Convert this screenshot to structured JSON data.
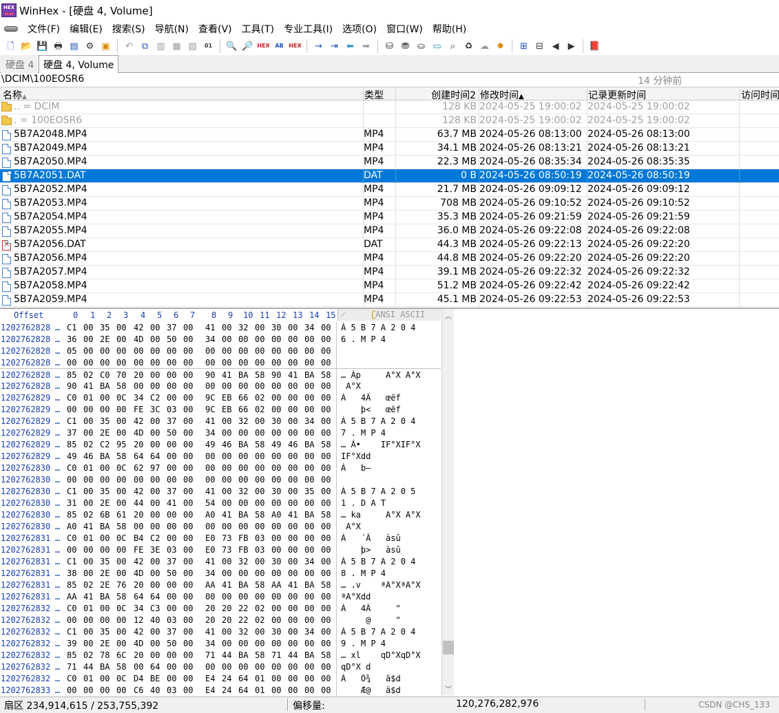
{
  "window": {
    "title": "WinHex - [硬盘 4, Volume]",
    "logo_text": "HEX"
  },
  "menu": [
    "文件(F)",
    "编辑(E)",
    "搜索(S)",
    "导航(N)",
    "查看(V)",
    "工具(T)",
    "专业工具(I)",
    "选项(O)",
    "窗口(W)",
    "帮助(H)"
  ],
  "toolbar": {
    "groups": [
      [
        {
          "icon": "new-file-icon",
          "glyph": "🗋",
          "color": "c-blue"
        },
        {
          "icon": "open-folder-icon",
          "glyph": "📂",
          "color": "c-orange"
        },
        {
          "icon": "save-icon",
          "glyph": "💾",
          "color": "c-gray"
        },
        {
          "icon": "print-icon",
          "glyph": "🖶",
          "color": ""
        },
        {
          "icon": "properties-icon",
          "glyph": "▤",
          "color": "c-blue"
        },
        {
          "icon": "settings-icon",
          "glyph": "⚙",
          "color": ""
        },
        {
          "icon": "execute-icon",
          "glyph": "▣",
          "color": "c-orange"
        }
      ],
      [
        {
          "icon": "undo-icon",
          "glyph": "↶",
          "color": "c-gray"
        },
        {
          "icon": "copy-icon",
          "glyph": "⧉",
          "color": "c-blue"
        },
        {
          "icon": "cut-icon",
          "glyph": "▥",
          "color": "c-gray"
        },
        {
          "icon": "paste-icon",
          "glyph": "▦",
          "color": "c-gray"
        },
        {
          "icon": "paste-special-icon",
          "glyph": "▧",
          "color": "c-gray"
        },
        {
          "icon": "copy-hex-icon",
          "glyph": "01",
          "color": "",
          "small": true
        }
      ],
      [
        {
          "icon": "find-icon",
          "glyph": "🔍",
          "color": "c-blue"
        },
        {
          "icon": "find-next-icon",
          "glyph": "🔎",
          "color": ""
        },
        {
          "icon": "find-hex-icon",
          "glyph": "HEX",
          "color": "c-red",
          "small": true
        },
        {
          "icon": "replace-text-icon",
          "glyph": "AB",
          "color": "c-blue",
          "small": true
        },
        {
          "icon": "replace-hex-icon",
          "glyph": "HEX",
          "color": "c-red",
          "small": true
        }
      ],
      [
        {
          "icon": "goto-offset-icon",
          "glyph": "→",
          "color": "c-blue"
        },
        {
          "icon": "goto-sector-icon",
          "glyph": "⇥",
          "color": "c-blue"
        },
        {
          "icon": "back-icon",
          "glyph": "⬅",
          "color": "c-teal"
        },
        {
          "icon": "forward-icon",
          "glyph": "➡",
          "color": "c-gray"
        }
      ],
      [
        {
          "icon": "open-disk-icon",
          "glyph": "⛁",
          "color": ""
        },
        {
          "icon": "clone-disk-icon",
          "glyph": "⛃",
          "color": ""
        },
        {
          "icon": "image-disk-icon",
          "glyph": "⛀",
          "color": ""
        },
        {
          "icon": "ram-editor-icon",
          "glyph": "▭",
          "color": "c-teal"
        },
        {
          "icon": "analyze-icon",
          "glyph": "⌕",
          "color": ""
        },
        {
          "icon": "trash-icon",
          "glyph": "♻",
          "color": ""
        },
        {
          "icon": "cloud-icon",
          "glyph": "☁",
          "color": "c-gray"
        },
        {
          "icon": "gear-yellow-icon",
          "glyph": "✹",
          "color": "c-orange"
        }
      ],
      [
        {
          "icon": "compare-icon",
          "glyph": "⊞",
          "color": "c-blue"
        },
        {
          "icon": "table-icon",
          "glyph": "⊟",
          "color": ""
        },
        {
          "icon": "prev-icon",
          "glyph": "◀",
          "color": ""
        },
        {
          "icon": "next-icon",
          "glyph": "▶",
          "color": ""
        }
      ],
      [
        {
          "icon": "help-book-icon",
          "glyph": "📕",
          "color": "c-purple"
        }
      ]
    ]
  },
  "tabs": [
    {
      "label": "硬盘 4",
      "active": false
    },
    {
      "label": "硬盘 4, Volume",
      "active": true
    }
  ],
  "path": {
    "text": "\\DCIM\\100EOSR6",
    "ago": "14 分钟前"
  },
  "columns": {
    "name": "名称",
    "type": "类型",
    "created": "创建时间2",
    "modified": "修改时间",
    "record": "记录更新时间",
    "access": "访问时间"
  },
  "files": [
    {
      "kind": "parent",
      "name": "..  =  DCIM",
      "type": "",
      "size": "128 KB",
      "mod": "2024-05-25  19:00:02",
      "rec": "2024-05-25  19:00:02"
    },
    {
      "kind": "parent",
      "name": ".  =  100EOSR6",
      "type": "",
      "size": "128 KB",
      "mod": "2024-05-25  19:00:02",
      "rec": "2024-05-25  19:00:02"
    },
    {
      "kind": "file",
      "name": "5B7A2048.MP4",
      "type": "MP4",
      "size": "63.7 MB",
      "mod": "2024-05-26  08:13:00",
      "rec": "2024-05-26  08:13:00"
    },
    {
      "kind": "file",
      "name": "5B7A2049.MP4",
      "type": "MP4",
      "size": "34.1 MB",
      "mod": "2024-05-26  08:13:21",
      "rec": "2024-05-26  08:13:21"
    },
    {
      "kind": "file",
      "name": "5B7A2050.MP4",
      "type": "MP4",
      "size": "22.3 MB",
      "mod": "2024-05-26  08:35:34",
      "rec": "2024-05-26  08:35:35"
    },
    {
      "kind": "selected",
      "name": "5B7A2051.DAT",
      "type": "DAT",
      "size": "0 B",
      "mod": "2024-05-26  08:50:19",
      "rec": "2024-05-26  08:50:19"
    },
    {
      "kind": "file",
      "name": "5B7A2052.MP4",
      "type": "MP4",
      "size": "21.7 MB",
      "mod": "2024-05-26  09:09:12",
      "rec": "2024-05-26  09:09:12"
    },
    {
      "kind": "file",
      "name": "5B7A2053.MP4",
      "type": "MP4",
      "size": "708 MB",
      "mod": "2024-05-26  09:10:52",
      "rec": "2024-05-26  09:10:52"
    },
    {
      "kind": "file",
      "name": "5B7A2054.MP4",
      "type": "MP4",
      "size": "35.3 MB",
      "mod": "2024-05-26  09:21:59",
      "rec": "2024-05-26  09:21:59"
    },
    {
      "kind": "file",
      "name": "5B7A2055.MP4",
      "type": "MP4",
      "size": "36.0 MB",
      "mod": "2024-05-26  09:22:08",
      "rec": "2024-05-26  09:22:08"
    },
    {
      "kind": "deleted",
      "name": "5B7A2056.DAT",
      "type": "DAT",
      "size": "44.3 MB",
      "mod": "2024-05-26  09:22:13",
      "rec": "2024-05-26  09:22:20"
    },
    {
      "kind": "file",
      "name": "5B7A2056.MP4",
      "type": "MP4",
      "size": "44.8 MB",
      "mod": "2024-05-26  09:22:20",
      "rec": "2024-05-26  09:22:20"
    },
    {
      "kind": "file",
      "name": "5B7A2057.MP4",
      "type": "MP4",
      "size": "39.1 MB",
      "mod": "2024-05-26  09:22:32",
      "rec": "2024-05-26  09:22:32"
    },
    {
      "kind": "file",
      "name": "5B7A2058.MP4",
      "type": "MP4",
      "size": "51.2 MB",
      "mod": "2024-05-26  09:22:42",
      "rec": "2024-05-26  09:22:42"
    },
    {
      "kind": "file",
      "name": "5B7A2059.MP4",
      "type": "MP4",
      "size": "45.1 MB",
      "mod": "2024-05-26  09:22:53",
      "rec": "2024-05-26  09:22:53"
    }
  ],
  "hex": {
    "offset_label": "Offset",
    "col_labels": [
      "0",
      "1",
      "2",
      "3",
      "4",
      "5",
      "6",
      "7",
      "8",
      "9",
      "10",
      "11",
      "12",
      "13",
      "14",
      "15"
    ],
    "ascii_label": "ANSI ASCII",
    "rows": [
      {
        "off": "1202762828",
        "grp": false,
        "b": "C1 00 35 00 42 00 37 00 41 00 32 00 30 00 34 00",
        "a": "Á 5 B 7 A 2 0 4"
      },
      {
        "off": "1202762828",
        "grp": false,
        "b": "36 00 2E 00 4D 00 50 00 34 00 00 00 00 00 00 00",
        "a": "6 . M P 4"
      },
      {
        "off": "1202762828",
        "grp": false,
        "b": "05 00 00 00 00 00 00 00 00 00 00 00 00 00 00 00",
        "a": ""
      },
      {
        "off": "1202762828",
        "grp": false,
        "b": "00 00 00 00 00 00 00 00 00 00 00 00 00 00 00 00",
        "a": ""
      },
      {
        "off": "1202762828",
        "grp": true,
        "b": "85 02 C0 70 20 00 00 00 90 41 BA 58 90 41 BA 58",
        "a": "… Àp     A°X A°X"
      },
      {
        "off": "1202762828",
        "grp": false,
        "b": "90 41 BA 58 00 00 00 00 00 00 00 00 00 00 00 00",
        "a": " A°X"
      },
      {
        "off": "1202762829",
        "grp": false,
        "b": "C0 01 00 0C 34 C2 00 00 9C EB 66 02 00 00 00 00",
        "a": "À   4Â   œëf"
      },
      {
        "off": "1202762829",
        "grp": false,
        "b": "00 00 00 00 FE 3C 03 00 9C EB 66 02 00 00 00 00",
        "a": "    þ<   œëf"
      },
      {
        "off": "1202762829",
        "grp": false,
        "b": "C1 00 35 00 42 00 37 00 41 00 32 00 30 00 34 00",
        "a": "Á 5 B 7 A 2 0 4"
      },
      {
        "off": "1202762829",
        "grp": false,
        "b": "37 00 2E 00 4D 00 50 00 34 00 00 00 00 00 00 00",
        "a": "7 . M P 4"
      },
      {
        "off": "1202762829",
        "grp": false,
        "b": "85 02 C2 95 20 00 00 00 49 46 BA 58 49 46 BA 58",
        "a": "… Â•    IF°XIF°X"
      },
      {
        "off": "1202762829",
        "grp": false,
        "b": "49 46 BA 58 64 64 00 00 00 00 00 00 00 00 00 00",
        "a": "IF°Xdd"
      },
      {
        "off": "1202762830",
        "grp": false,
        "b": "C0 01 00 0C 62 97 00 00 00 00 00 00 00 00 00 00",
        "a": "À   b—"
      },
      {
        "off": "1202762830",
        "grp": false,
        "b": "00 00 00 00 00 00 00 00 00 00 00 00 00 00 00 00",
        "a": ""
      },
      {
        "off": "1202762830",
        "grp": false,
        "b": "C1 00 35 00 42 00 37 00 41 00 32 00 30 00 35 00",
        "a": "Á 5 B 7 A 2 0 5"
      },
      {
        "off": "1202762830",
        "grp": false,
        "b": "31 00 2E 00 44 00 41 00 54 00 00 00 00 00 00 00",
        "a": "1 . D A T"
      },
      {
        "off": "1202762830",
        "grp": false,
        "b": "85 02 6B 61 20 00 00 00 A0 41 BA 58 A0 41 BA 58",
        "a": "… ka     A°X A°X"
      },
      {
        "off": "1202762830",
        "grp": false,
        "b": "A0 41 BA 58 00 00 00 00 00 00 00 00 00 00 00 00",
        "a": " A°X"
      },
      {
        "off": "1202762831",
        "grp": false,
        "b": "C0 01 00 0C B4 C2 00 00 E0 73 FB 03 00 00 00 00",
        "a": "À   ´Â   àsû"
      },
      {
        "off": "1202762831",
        "grp": false,
        "b": "00 00 00 00 FE 3E 03 00 E0 73 FB 03 00 00 00 00",
        "a": "    þ>   àsû"
      },
      {
        "off": "1202762831",
        "grp": false,
        "b": "C1 00 35 00 42 00 37 00 41 00 32 00 30 00 34 00",
        "a": "Á 5 B 7 A 2 0 4"
      },
      {
        "off": "1202762831",
        "grp": false,
        "b": "38 00 2E 00 4D 00 50 00 34 00 00 00 00 00 00 00",
        "a": "8 . M P 4"
      },
      {
        "off": "1202762831",
        "grp": false,
        "b": "85 02 2E 76 20 00 00 00 AA 41 BA 58 AA 41 BA 58",
        "a": "… .v    ªA°XªA°X"
      },
      {
        "off": "1202762831",
        "grp": false,
        "b": "AA 41 BA 58 64 64 00 00 00 00 00 00 00 00 00 00",
        "a": "ªA°Xdd"
      },
      {
        "off": "1202762832",
        "grp": false,
        "b": "C0 01 00 0C 34 C3 00 00 20 20 22 02 00 00 00 00",
        "a": "À   4Ã     \""
      },
      {
        "off": "1202762832",
        "grp": false,
        "b": "00 00 00 00 12 40 03 00 20 20 22 02 00 00 00 00",
        "a": "     @     \""
      },
      {
        "off": "1202762832",
        "grp": false,
        "b": "C1 00 35 00 42 00 37 00 41 00 32 00 30 00 34 00",
        "a": "Á 5 B 7 A 2 0 4"
      },
      {
        "off": "1202762832",
        "grp": false,
        "b": "39 00 2E 00 4D 00 50 00 34 00 00 00 00 00 00 00",
        "a": "9 . M P 4"
      },
      {
        "off": "1202762832",
        "grp": false,
        "b": "85 02 78 6C 20 00 00 00 71 44 BA 58 71 44 BA 58",
        "a": "… xl    qD°XqD°X"
      },
      {
        "off": "1202762832",
        "grp": false,
        "b": "71 44 BA 58 00 64 00 00 00 00 00 00 00 00 00 00",
        "a": "qD°X d"
      },
      {
        "off": "1202762832",
        "grp": false,
        "b": "C0 01 00 0C D4 BE 00 00 E4 24 64 01 00 00 00 00",
        "a": "À   Ô¾   ä$d"
      },
      {
        "off": "1202762833",
        "grp": false,
        "b": "00 00 00 00 C6 40 03 00 E4 24 64 01 00 00 00 00",
        "a": "    Æ@   ä$d"
      }
    ]
  },
  "status": {
    "sector": "扇区 234,914,615 / 253,755,392",
    "offset_label": "偏移量:",
    "offset_value": "120,276,282,976",
    "watermark": "CSDN @CHS_133"
  }
}
